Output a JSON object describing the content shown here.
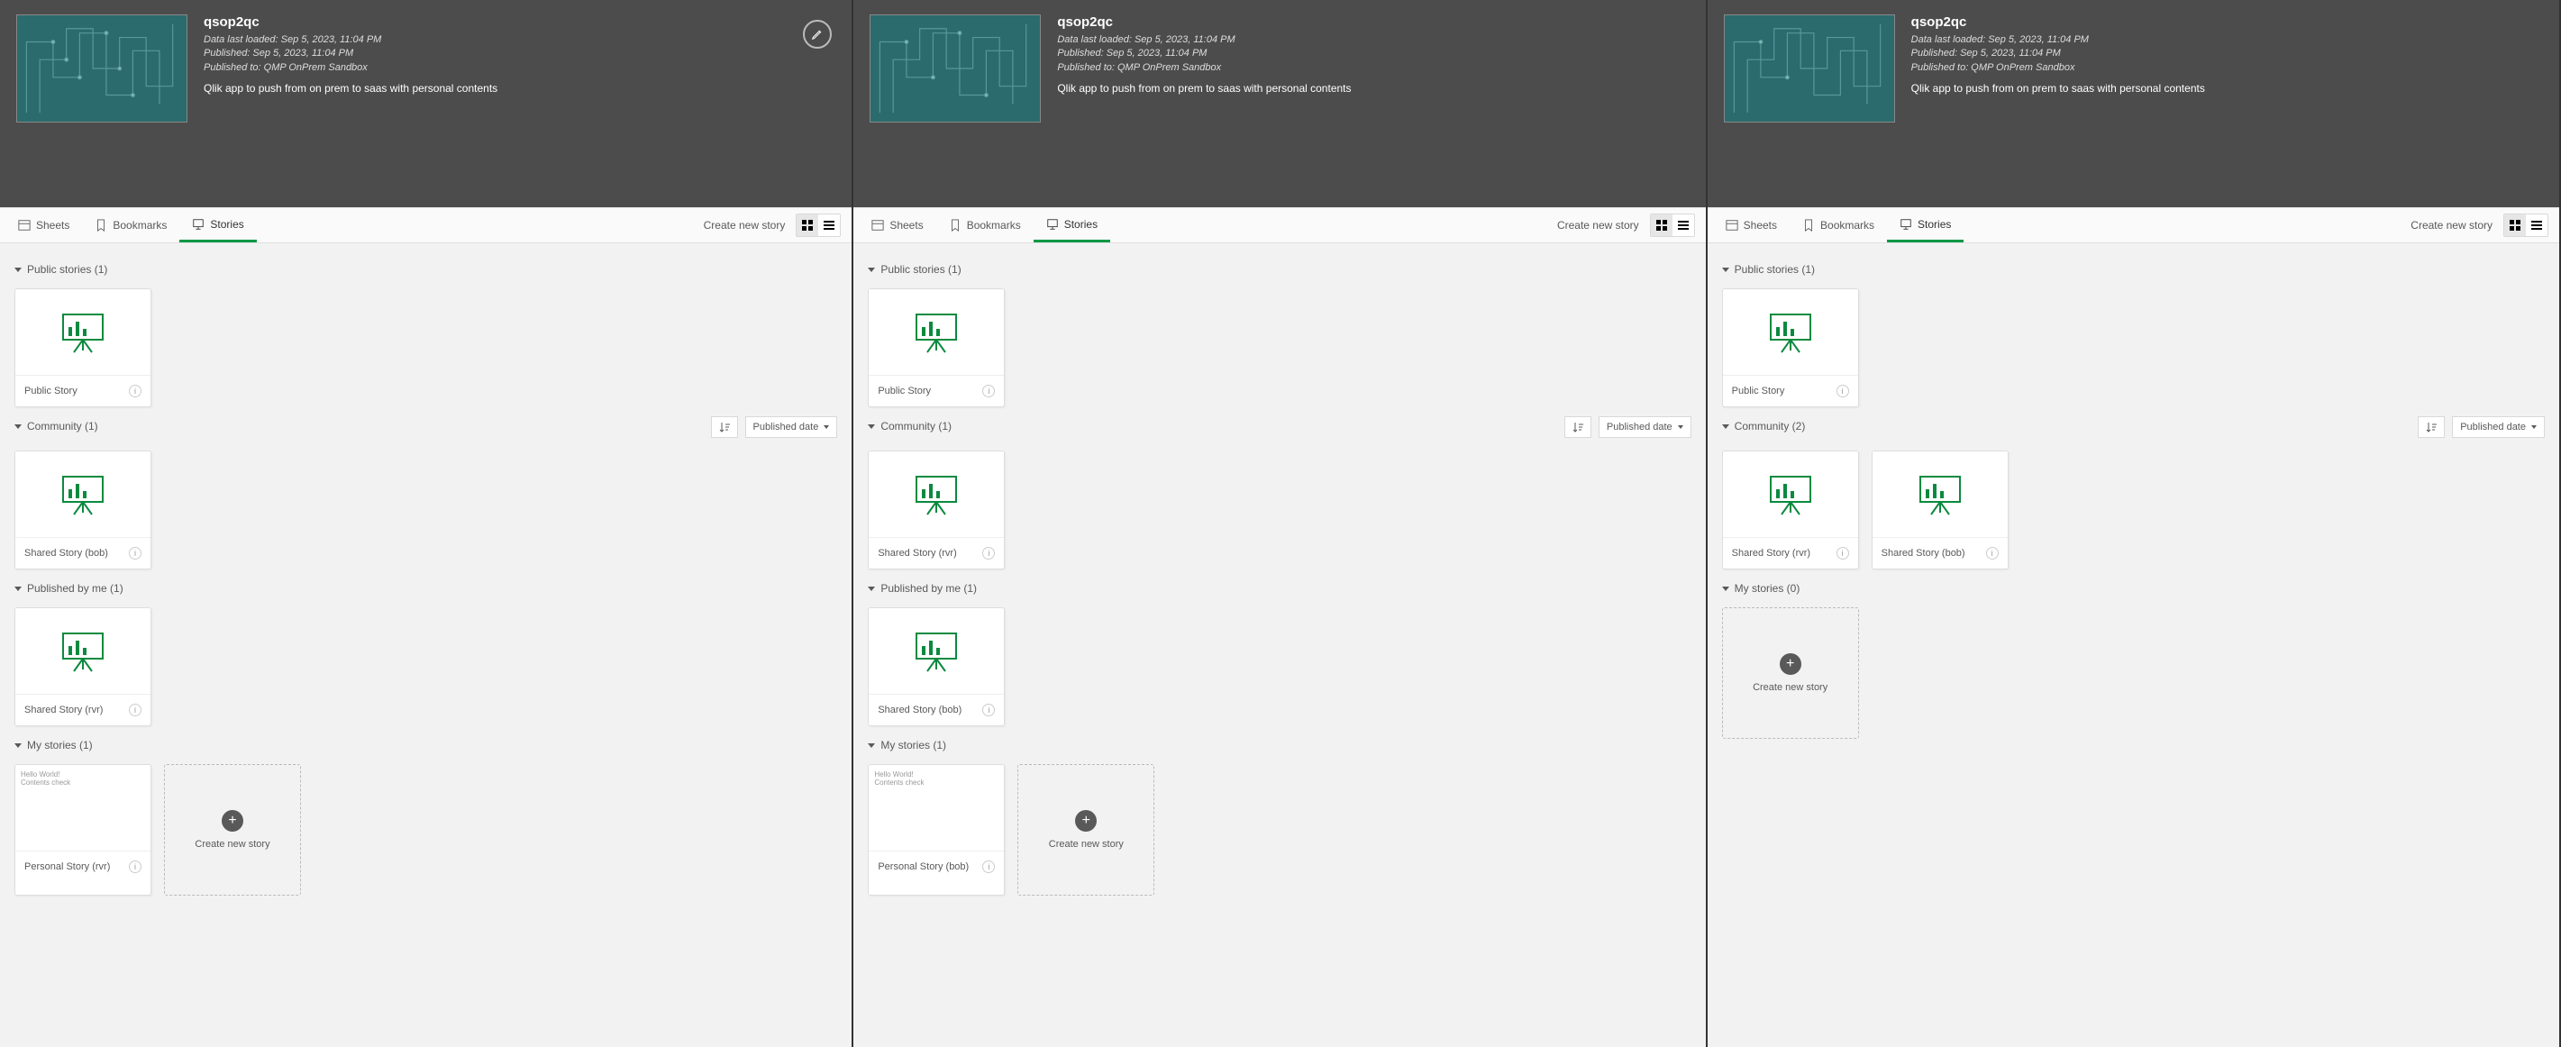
{
  "app": {
    "title": "qsop2qc",
    "loaded": "Data last loaded: Sep 5, 2023, 11:04 PM",
    "published": "Published: Sep 5, 2023, 11:04 PM",
    "publishedTo": "Published to: QMP OnPrem Sandbox",
    "desc": "Qlik app to push from on prem to saas with personal contents"
  },
  "tabs": {
    "sheets": "Sheets",
    "bookmarks": "Bookmarks",
    "stories": "Stories"
  },
  "actions": {
    "createNewStory": "Create new story",
    "createNewStoryCard": "Create new story",
    "sortLabel": "Published date"
  },
  "panel1": {
    "sections": {
      "public": {
        "label": "Public stories (1)",
        "cards": [
          "Public Story"
        ]
      },
      "community": {
        "label": "Community (1)",
        "cards": [
          "Shared Story (bob)"
        ],
        "hasSort": true
      },
      "pubByMe": {
        "label": "Published by me (1)",
        "cards": [
          "Shared Story (rvr)"
        ]
      },
      "my": {
        "label": "My stories (1)",
        "cards": [
          "Personal Story (rvr)"
        ],
        "createCard": true,
        "textThumb": true
      }
    }
  },
  "panel2": {
    "sections": {
      "public": {
        "label": "Public stories (1)",
        "cards": [
          "Public Story"
        ]
      },
      "community": {
        "label": "Community (1)",
        "cards": [
          "Shared Story (rvr)"
        ],
        "hasSort": true
      },
      "pubByMe": {
        "label": "Published by me (1)",
        "cards": [
          "Shared Story (bob)"
        ]
      },
      "my": {
        "label": "My stories (1)",
        "cards": [
          "Personal Story (bob)"
        ],
        "createCard": true,
        "textThumb": true
      }
    }
  },
  "panel3": {
    "sections": {
      "public": {
        "label": "Public stories (1)",
        "cards": [
          "Public Story"
        ]
      },
      "community": {
        "label": "Community (2)",
        "cards": [
          "Shared Story (rvr)",
          "Shared Story (bob)"
        ],
        "hasSort": true
      },
      "my": {
        "label": "My stories (0)",
        "cards": [],
        "createCard": true
      }
    }
  },
  "thumbText": {
    "l1": "Hello World!",
    "l2": "Contents check"
  }
}
